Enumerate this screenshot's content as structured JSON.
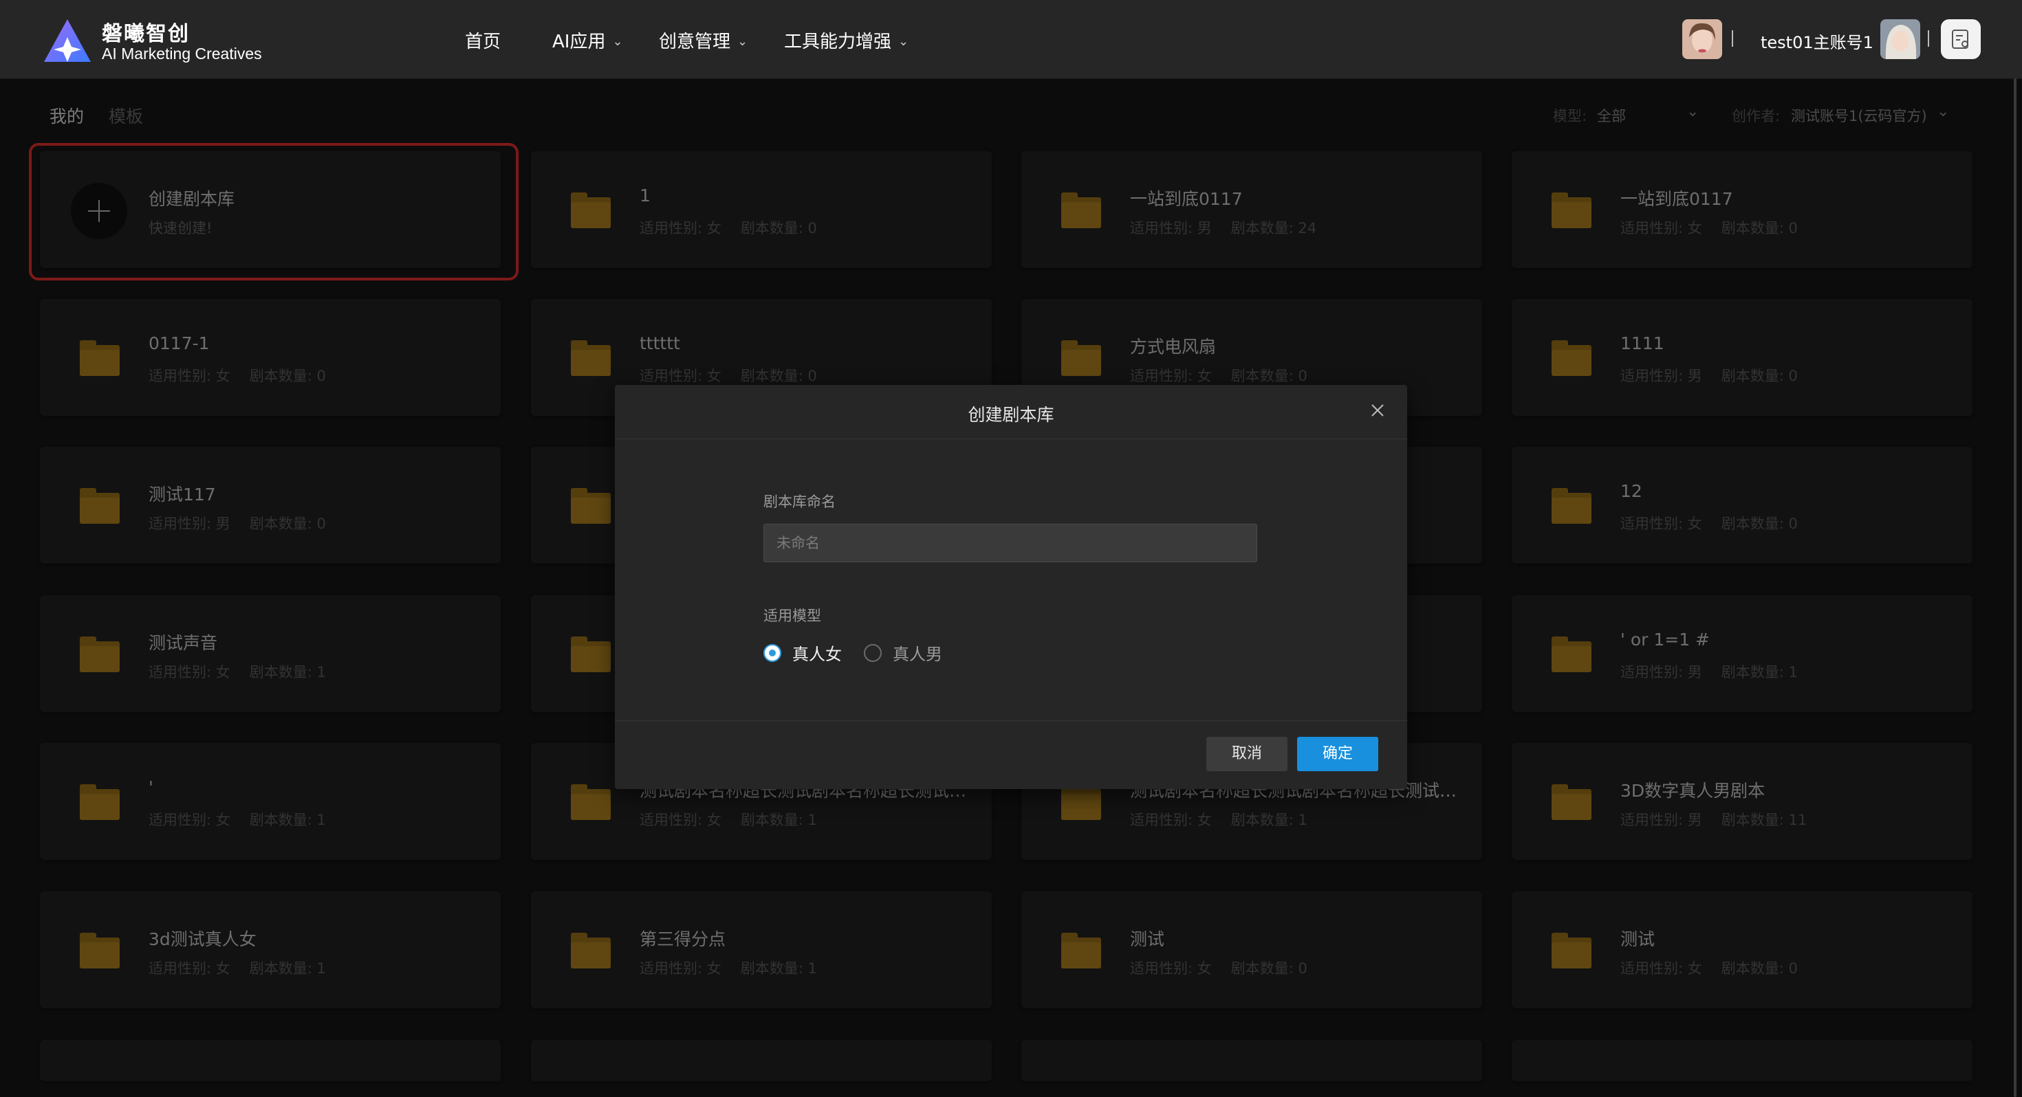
{
  "nav": {
    "brand_name": "磐曦智创",
    "brand_sub": "AI Marketing Creatives",
    "items": [
      "首页",
      "AI应用",
      "创意管理",
      "工具能力增强"
    ],
    "username": "test01主账号1"
  },
  "subheader": {
    "tabs": [
      "我的",
      "模板"
    ],
    "model_label": "模型:",
    "model_value": "全部",
    "creator_label": "创作者:",
    "creator_value": "测试账号1(云码官方)"
  },
  "create_card": {
    "title": "创建剧本库",
    "subtitle": "快速创建!"
  },
  "libraries": [
    {
      "name": "1",
      "gender": "适用性别: 女",
      "count": "剧本数量: 0"
    },
    {
      "name": "一站到底0117",
      "gender": "适用性别: 男",
      "count": "剧本数量: 24"
    },
    {
      "name": "一站到底0117",
      "gender": "适用性别: 女",
      "count": "剧本数量: 0"
    },
    {
      "name": "0117-1",
      "gender": "适用性别: 女",
      "count": "剧本数量: 0"
    },
    {
      "name": "tttttt",
      "gender": "适用性别: 女",
      "count": "剧本数量: 0"
    },
    {
      "name": "方式电风扇",
      "gender": "适用性别: 女",
      "count": "剧本数量: 0"
    },
    {
      "name": "1111",
      "gender": "适用性别: 男",
      "count": "剧本数量: 0"
    },
    {
      "name": "测试117",
      "gender": "适用性别: 男",
      "count": "剧本数量: 0"
    },
    {
      "name": "",
      "gender": "",
      "count": ""
    },
    {
      "name": "",
      "gender": "",
      "count": ""
    },
    {
      "name": "12",
      "gender": "适用性别: 女",
      "count": "剧本数量: 0"
    },
    {
      "name": "测试声音",
      "gender": "适用性别: 女",
      "count": "剧本数量: 1"
    },
    {
      "name": "",
      "gender": "",
      "count": ""
    },
    {
      "name": "",
      "gender": "",
      "count": ""
    },
    {
      "name": "' or 1=1 #",
      "gender": "适用性别: 男",
      "count": "剧本数量: 1"
    },
    {
      "name": "'",
      "gender": "适用性别: 女",
      "count": "剧本数量: 1"
    },
    {
      "name": "测试剧本名称超长测试剧本名称超长测试剧本名称超长",
      "gender": "适用性别: 女",
      "count": "剧本数量: 1"
    },
    {
      "name": "测试剧本名称超长测试剧本名称超长测试剧本名称超长",
      "gender": "适用性别: 女",
      "count": "剧本数量: 1"
    },
    {
      "name": "3D数字真人男剧本",
      "gender": "适用性别: 男",
      "count": "剧本数量: 11"
    },
    {
      "name": "3d测试真人女",
      "gender": "适用性别: 女",
      "count": "剧本数量: 1"
    },
    {
      "name": "第三得分点",
      "gender": "适用性别: 女",
      "count": "剧本数量: 1"
    },
    {
      "name": "测试",
      "gender": "适用性别: 女",
      "count": "剧本数量: 0"
    },
    {
      "name": "测试",
      "gender": "适用性别: 女",
      "count": "剧本数量: 0"
    }
  ],
  "modal": {
    "title": "创建剧本库",
    "name_label": "剧本库命名",
    "name_placeholder": "未命名",
    "name_value": "",
    "model_label": "适用模型",
    "options": [
      "真人女",
      "真人男"
    ],
    "selected": "真人女",
    "cancel": "取消",
    "confirm": "确定"
  },
  "colors": {
    "accent": "#1890de",
    "folder": "#b08220",
    "highlight": "#e2302c",
    "background": "#161616"
  }
}
